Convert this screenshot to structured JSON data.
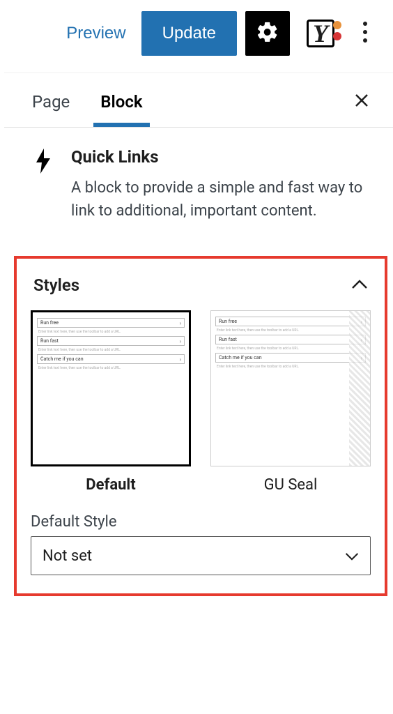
{
  "toolbar": {
    "preview_label": "Preview",
    "update_label": "Update"
  },
  "tabs": {
    "items": [
      "Page",
      "Block"
    ],
    "active_index": 1
  },
  "block_info": {
    "title": "Quick Links",
    "description": "A block to provide a simple and fast way to link to additional, important content."
  },
  "styles_panel": {
    "title": "Styles",
    "options": [
      {
        "label": "Default",
        "selected": true
      },
      {
        "label": "GU Seal",
        "selected": false
      }
    ],
    "thumb_lines": {
      "row1": "Run free",
      "row2": "Run fast",
      "row3": "Catch me if you can",
      "hint": "Enter link text here, then use the toolbar to add a URL."
    },
    "default_style_label": "Default Style",
    "default_style_value": "Not set"
  }
}
